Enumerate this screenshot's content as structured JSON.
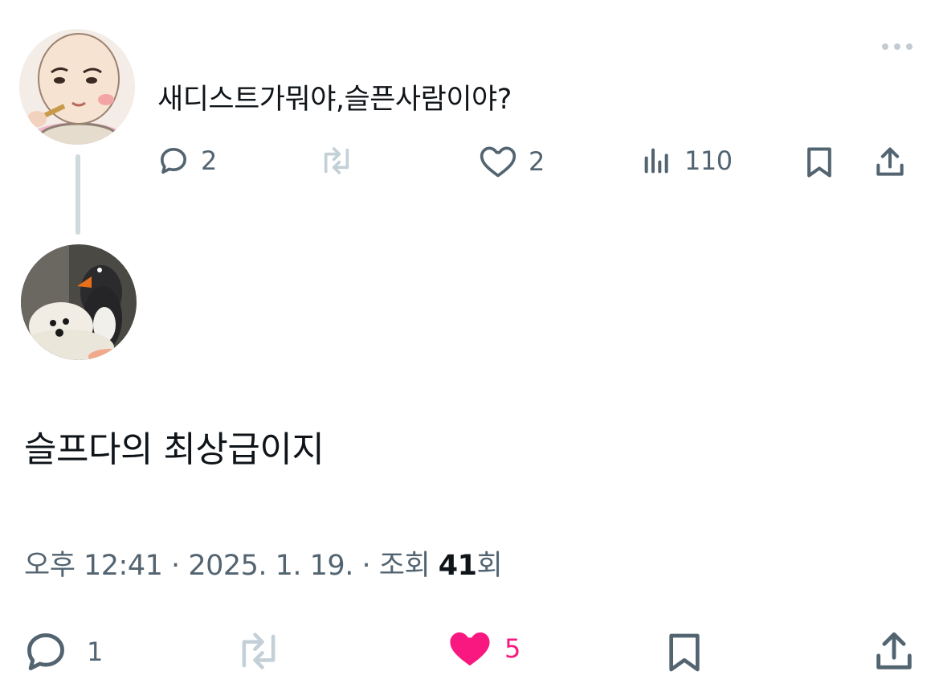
{
  "reply_tweet": {
    "text": "새디스트가뭐야,슬픈사람이야?",
    "reply_count": "2",
    "retweet_count": "",
    "like_count": "2",
    "view_count": "110"
  },
  "main_tweet": {
    "text": "슬프다의 최상급이지",
    "time": "오후 12:41",
    "separator": "·",
    "date": "2025. 1. 19.",
    "views_label": "조회",
    "views_count": "41",
    "views_suffix": "회",
    "reply_count": "1",
    "retweet_count": "",
    "like_count": "5",
    "liked": true
  },
  "icons": {
    "reply": "reply-icon",
    "retweet": "retweet-icon",
    "like": "heart-icon",
    "views": "views-chart-icon",
    "bookmark": "bookmark-icon",
    "share": "share-icon",
    "more": "more-dots-icon"
  },
  "colors": {
    "text_primary": "#0f1419",
    "text_secondary": "#536471",
    "like_active": "#f91880",
    "retweet_muted": "#c4d0d8",
    "thread_line": "#cfd9de"
  }
}
